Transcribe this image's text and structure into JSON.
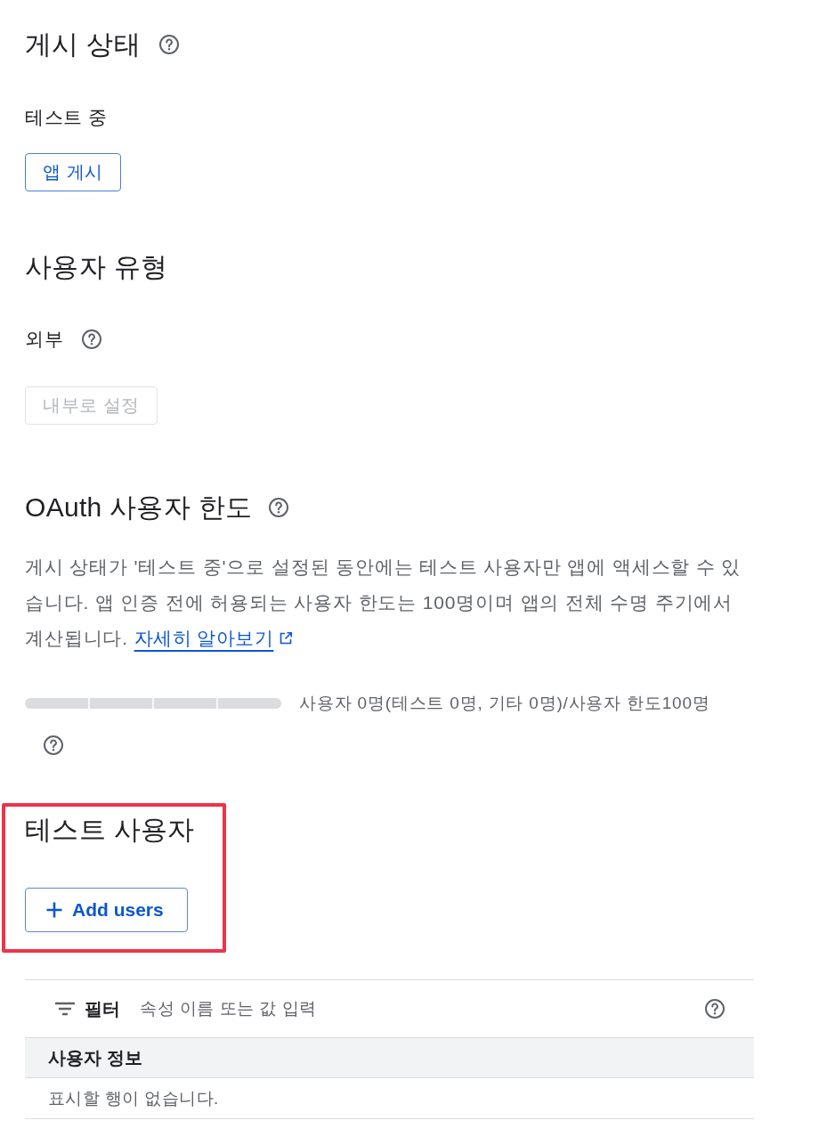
{
  "publishing_status": {
    "title": "게시 상태",
    "status": "테스트 중",
    "button": {
      "label": "앱 게시",
      "disabled": false
    }
  },
  "user_type": {
    "title": "사용자 유형",
    "value": "외부",
    "button": {
      "label": "내부로 설정",
      "disabled": true
    }
  },
  "oauth_limit": {
    "title": "OAuth 사용자 한도",
    "description": "게시 상태가 '테스트 중'으로 설정된 동안에는 테스트 사용자만 앱에 액세스할 수 있습니다. 앱 인증 전에 허용되는 사용자 한도는 100명이며 앱의 전체 수명 주기에서 계산됩니다.",
    "link": "자세히 알아보기",
    "usage": {
      "level": 0,
      "reading": "사용자 0명(테스트 0명, 기타 0명)/사용자 한도100명"
    }
  },
  "test_users": {
    "title": "테스트 사용자",
    "highlighted": true,
    "add_button": {
      "label": "Add users"
    },
    "filter": {
      "label": "필터",
      "placeholder": "속성 이름 또는 값 입력"
    },
    "table": {
      "columns": [
        "사용자 정보"
      ],
      "empty_message": "표시할 행이 없습니다."
    }
  }
}
